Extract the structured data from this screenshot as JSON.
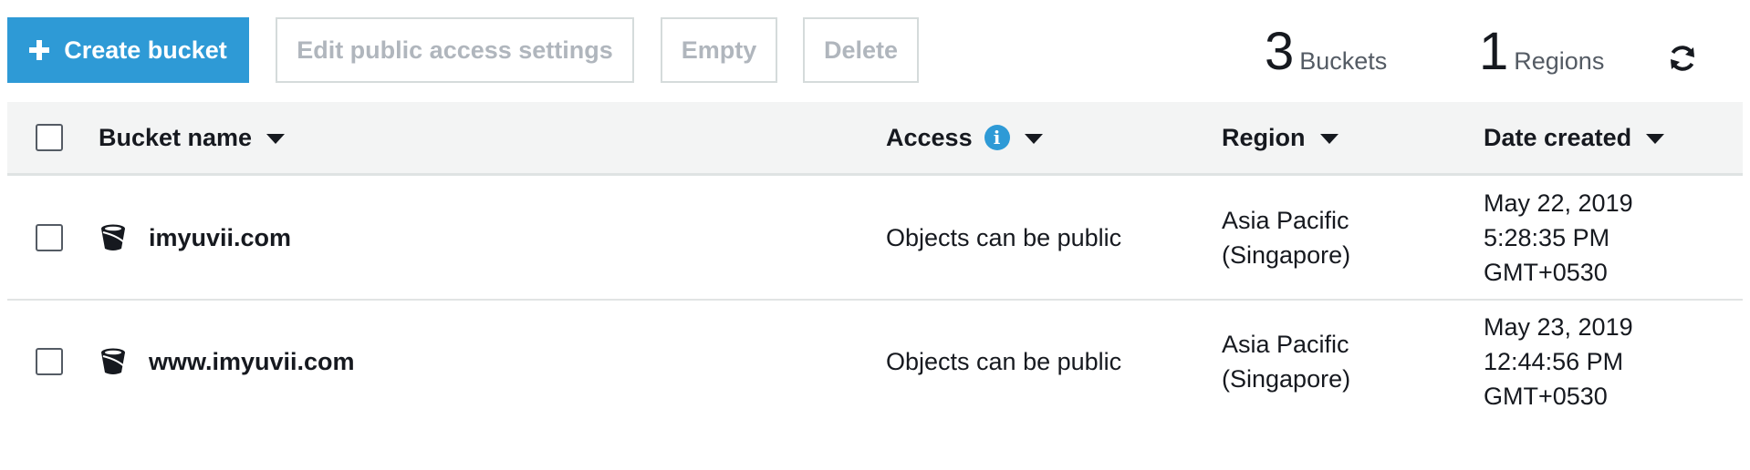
{
  "toolbar": {
    "create_label": "Create bucket",
    "edit_label": "Edit public access settings",
    "empty_label": "Empty",
    "delete_label": "Delete"
  },
  "summary": {
    "buckets_count": "3",
    "buckets_label": "Buckets",
    "regions_count": "1",
    "regions_label": "Regions"
  },
  "table": {
    "columns": {
      "name": "Bucket name",
      "access": "Access",
      "region": "Region",
      "date": "Date created"
    },
    "rows": [
      {
        "name": "imyuvii.com",
        "access": "Objects can be public",
        "region_line1": "Asia Pacific",
        "region_line2": "(Singapore)",
        "date_line1": "May 22, 2019",
        "date_line2": "5:28:35 PM",
        "date_line3": "GMT+0530"
      },
      {
        "name": "www.imyuvii.com",
        "access": "Objects can be public",
        "region_line1": "Asia Pacific",
        "region_line2": "(Singapore)",
        "date_line1": "May 23, 2019",
        "date_line2": "12:44:56 PM",
        "date_line3": "GMT+0530"
      }
    ]
  },
  "icons": {
    "create": "plus-icon",
    "refresh": "refresh-icon",
    "info": "info-icon",
    "sort": "caret-down-icon",
    "bucket": "bucket-icon"
  },
  "colors": {
    "primary": "#2e9ad6",
    "header_bg": "#f3f4f4",
    "disabled_text": "#b0b6bd",
    "text": "#16191f"
  }
}
